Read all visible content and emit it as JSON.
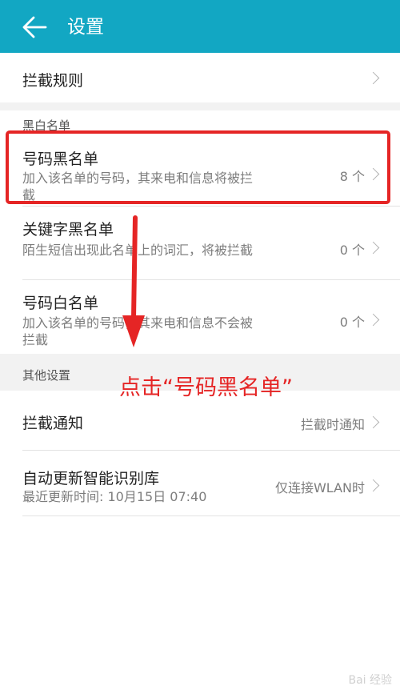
{
  "header": {
    "title": "设置"
  },
  "rows": {
    "rules": {
      "title": "拦截规则"
    },
    "blacklist_section": "黑白名单",
    "number_black": {
      "title": "号码黑名单",
      "sub": "加入该名单的号码，其来电和信息将被拦截",
      "value": "8 个"
    },
    "keyword_black": {
      "title": "关键字黑名单",
      "sub": "陌生短信出现此名单上的词汇，将被拦截",
      "value": "0 个"
    },
    "number_white": {
      "title": "号码白名单",
      "sub": "加入该名单的号码，其来电和信息不会被拦截",
      "value": "0 个"
    },
    "other_section": "其他设置",
    "notify": {
      "title": "拦截通知",
      "value": "拦截时通知"
    },
    "update": {
      "title": "自动更新智能识别库",
      "sub": "最近更新时间: 10月15日 07:40",
      "value": "仅连接WLAN时"
    }
  },
  "annotation": {
    "text": "点击“号码黑名单”"
  },
  "watermark": "Bai 经验",
  "colors": {
    "appbar": "#12a7c3",
    "annotation": "#e52525"
  },
  "icons": [
    "back-arrow-icon",
    "chevron-right-icon"
  ]
}
